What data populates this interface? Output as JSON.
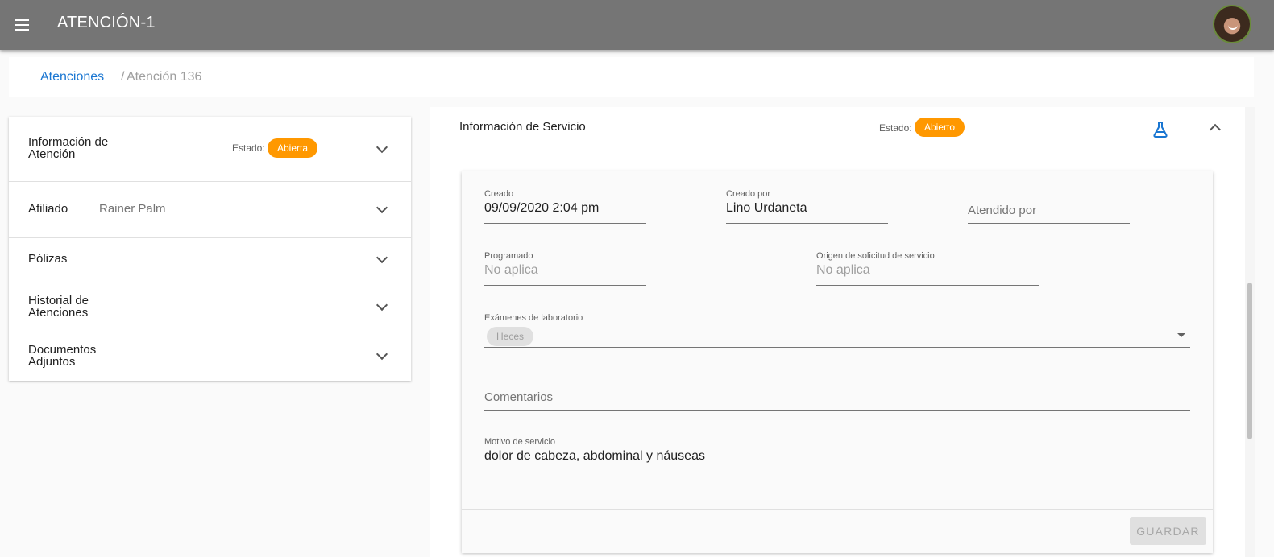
{
  "appbar": {
    "title": "ATENCIÓN-1",
    "menu_icon": "menu-icon",
    "avatar": "user-avatar"
  },
  "breadcrumb": {
    "parent": "Atenciones",
    "separator": "/",
    "current": "Atención 136"
  },
  "left_panel": {
    "sections": [
      {
        "title": "Información de Atención",
        "estado_label": "Estado:",
        "estado_value": "Abierta"
      },
      {
        "title": "Afiliado",
        "value": "Rainer Palm"
      },
      {
        "title": "Pólizas"
      },
      {
        "title": "Historial de Atenciones"
      },
      {
        "title": "Documentos Adjuntos"
      }
    ]
  },
  "service_panel": {
    "title": "Información de Servicio",
    "estado_label": "Estado:",
    "estado_value": "Abierto",
    "action_icon": "flask-icon",
    "fields": {
      "creado": {
        "label": "Creado",
        "value": "09/09/2020 2:04 pm"
      },
      "creado_por": {
        "label": "Creado por",
        "value": "Lino Urdaneta"
      },
      "atendido_por": {
        "placeholder": "Atendido por"
      },
      "programado": {
        "label": "Programado",
        "value": "No aplica"
      },
      "origen": {
        "label": "Origen de solicitud de servicio",
        "value": "No aplica"
      },
      "examenes": {
        "label": "Exámenes de laboratorio",
        "chips": [
          "Heces"
        ]
      },
      "comentarios": {
        "placeholder": "Comentarios"
      },
      "motivo": {
        "label": "Motivo de servicio",
        "value": "dolor de cabeza, abdominal y náuseas"
      }
    },
    "save_label": "GUARDAR"
  },
  "colors": {
    "appbar": "#757575",
    "accent": "#ff9800",
    "link": "#1976d2"
  }
}
